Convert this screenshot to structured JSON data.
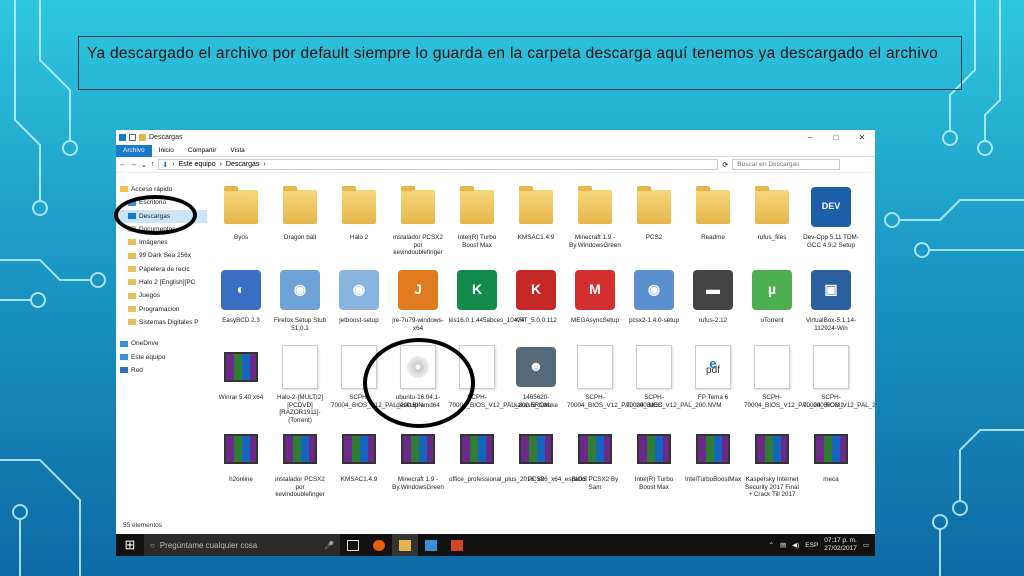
{
  "caption": "Ya descargado el archivo por default siempre lo guarda en la carpeta descarga aquí tenemos ya descargado el archivo",
  "window": {
    "title": "Descargas",
    "ribbon_tabs": [
      "Archivo",
      "Inicio",
      "Compartir",
      "Vista"
    ],
    "breadcrumb": [
      "Este equipo",
      "Descargas"
    ],
    "search_placeholder": "Buscar en Descargas",
    "status": "55 elementos"
  },
  "nav": [
    "Acceso rápido",
    "Escritorio",
    "Descargas",
    "Documentos",
    "Imágenes",
    "99 Dark Sea 256x",
    "Papelera de recic",
    "Halo 2 [English][PC",
    "Juegos",
    "Programacion",
    "Sistemas Digitales P",
    "OneDrive",
    "Este equipo",
    "Red"
  ],
  "files": [
    {
      "name": "Byos",
      "type": "folder"
    },
    {
      "name": "Dragon ball",
      "type": "folder"
    },
    {
      "name": "Halo 2",
      "type": "folder"
    },
    {
      "name": "instalador PCSX2 por kevindoublefinger",
      "type": "folder"
    },
    {
      "name": "Intel(R) Turbo Boost Max",
      "type": "folder"
    },
    {
      "name": "KMSAC1.4.9",
      "type": "folder"
    },
    {
      "name": "Minecraft 1.9 - By.WindowsGreen",
      "type": "folder"
    },
    {
      "name": "PCS2",
      "type": "folder"
    },
    {
      "name": "Readme",
      "type": "folder"
    },
    {
      "name": "rufus_files",
      "type": "folder"
    },
    {
      "name": "Dev-Cpp 5.11 TDM-GCC 4.9.2 Setup",
      "type": "app",
      "color": "#1a5fa8",
      "glyph": "DEV"
    },
    {
      "name": "EasyBCD 2.3",
      "type": "app",
      "color": "#3a6fc4",
      "glyph": "◐"
    },
    {
      "name": "Firefox Setup Stub 51.0.1",
      "type": "app",
      "color": "#6fa3d8",
      "glyph": "◉"
    },
    {
      "name": "jetboost-setup",
      "type": "app",
      "color": "#8ab4e0",
      "glyph": "◉"
    },
    {
      "name": "jre-7u79-windows-x64",
      "type": "app",
      "color": "#e07b20",
      "glyph": "J"
    },
    {
      "name": "kis16.0.1.445abces_10474",
      "type": "app",
      "color": "#128a4a",
      "glyph": "K"
    },
    {
      "name": "KRT_5.0.0.112",
      "type": "app",
      "color": "#c62828",
      "glyph": "K"
    },
    {
      "name": "MEGAsyncSetup",
      "type": "app",
      "color": "#d32f2f",
      "glyph": "M"
    },
    {
      "name": "pcsx2-1.4.0-setup",
      "type": "app",
      "color": "#5a8fd0",
      "glyph": "◉"
    },
    {
      "name": "rufus-2.12",
      "type": "app",
      "color": "#444",
      "glyph": "▬"
    },
    {
      "name": "uTorrent",
      "type": "app",
      "color": "#4caf50",
      "glyph": "µ"
    },
    {
      "name": "VirtualBox-5.1.14-112924-Win",
      "type": "app",
      "color": "#2a5fa0",
      "glyph": "▣"
    },
    {
      "name": "Winrar 5.40 x64",
      "type": "rar"
    },
    {
      "name": "Halo-2-[MULTI2][PCDVD][RAZOR1911]-(Torrent)",
      "type": "doc"
    },
    {
      "name": "SCPH-70004_BIOS_V12_PAL_200.BIN",
      "type": "doc"
    },
    {
      "name": "ubuntu-16.04.1-desktop-amd64",
      "type": "disc"
    },
    {
      "name": "SCPH-70004_BIOS_V12_PAL_200.EROM",
      "type": "doc"
    },
    {
      "name": "1465620-kakashi_hatake",
      "type": "app",
      "color": "#566a7a",
      "glyph": "☻"
    },
    {
      "name": "SCPH-70004_BIOS_V12_PAL_200.MEC",
      "type": "doc"
    },
    {
      "name": "SCPH-70004_BIOS_V12_PAL_200.NVM",
      "type": "doc"
    },
    {
      "name": "FP Tema 6",
      "type": "pdf"
    },
    {
      "name": "SCPH-70004_BIOS_V12_PAL_200.ROM1",
      "type": "doc"
    },
    {
      "name": "SCPH-70004_BIOS_V12_PAL_200.ROM2",
      "type": "doc"
    },
    {
      "name": "h2online",
      "type": "rar"
    },
    {
      "name": "instalador PCSX2 por kevindoublefinger",
      "type": "rar"
    },
    {
      "name": "KMSAC1.4.9",
      "type": "rar"
    },
    {
      "name": "Minecraft 1.9 - By.WindowsGreen",
      "type": "rar"
    },
    {
      "name": "office_professional_plus_2016_x86_x64_español",
      "type": "rar"
    },
    {
      "name": "PCS2",
      "type": "rar"
    },
    {
      "name": "BIOS PCSX2 By Sam",
      "type": "rar"
    },
    {
      "name": "Intel(R) Turbo Boost Max",
      "type": "rar"
    },
    {
      "name": "IntelTurboBoostMax",
      "type": "rar"
    },
    {
      "name": "Kaspersky Internet Security 2017 Final + Crack Till 2017",
      "type": "rar"
    },
    {
      "name": "meca",
      "type": "rar"
    }
  ],
  "taskbar": {
    "search": "Pregúntame cualquier cosa",
    "lang": "ESP",
    "time": "07:17 p. m.",
    "date": "27/02/2017"
  }
}
